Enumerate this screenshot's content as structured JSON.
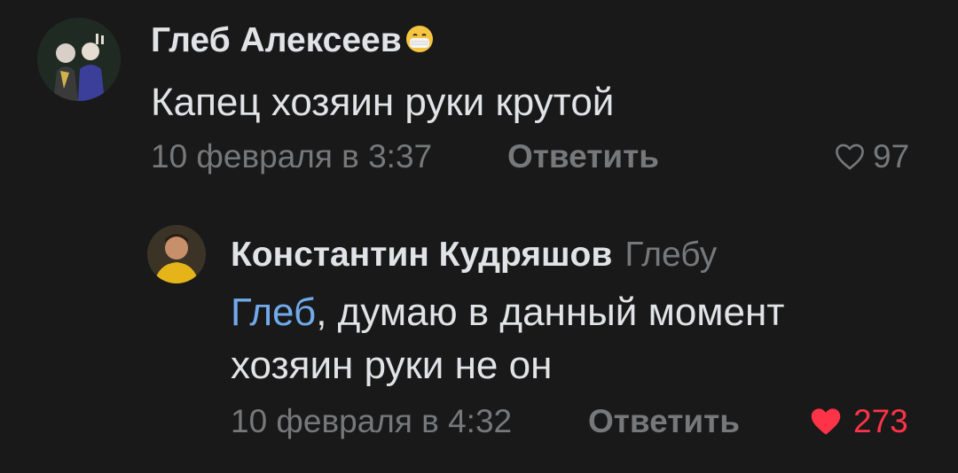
{
  "comments": [
    {
      "author": "Глеб Алексеев",
      "status_emoji_icon": "mask-face-emoji",
      "text": "Капец хозяин руки крутой",
      "date": "10 февраля в 3:37",
      "reply_label": "Ответить",
      "likes": "97",
      "liked": false
    }
  ],
  "reply": {
    "author": "Константин Кудряшов",
    "reply_to": "Глебу",
    "mention": "Глеб",
    "text_line1_rest": ", думаю в данный момент",
    "text_line2": "хозяин руки не он",
    "date": "10 февраля в 4:32",
    "reply_label": "Ответить",
    "likes": "273",
    "liked": true
  },
  "colors": {
    "background": "#19191a",
    "text": "#e1e3e6",
    "secondary": "#76787a",
    "link": "#71aaeb",
    "like_active": "#ff3347"
  }
}
